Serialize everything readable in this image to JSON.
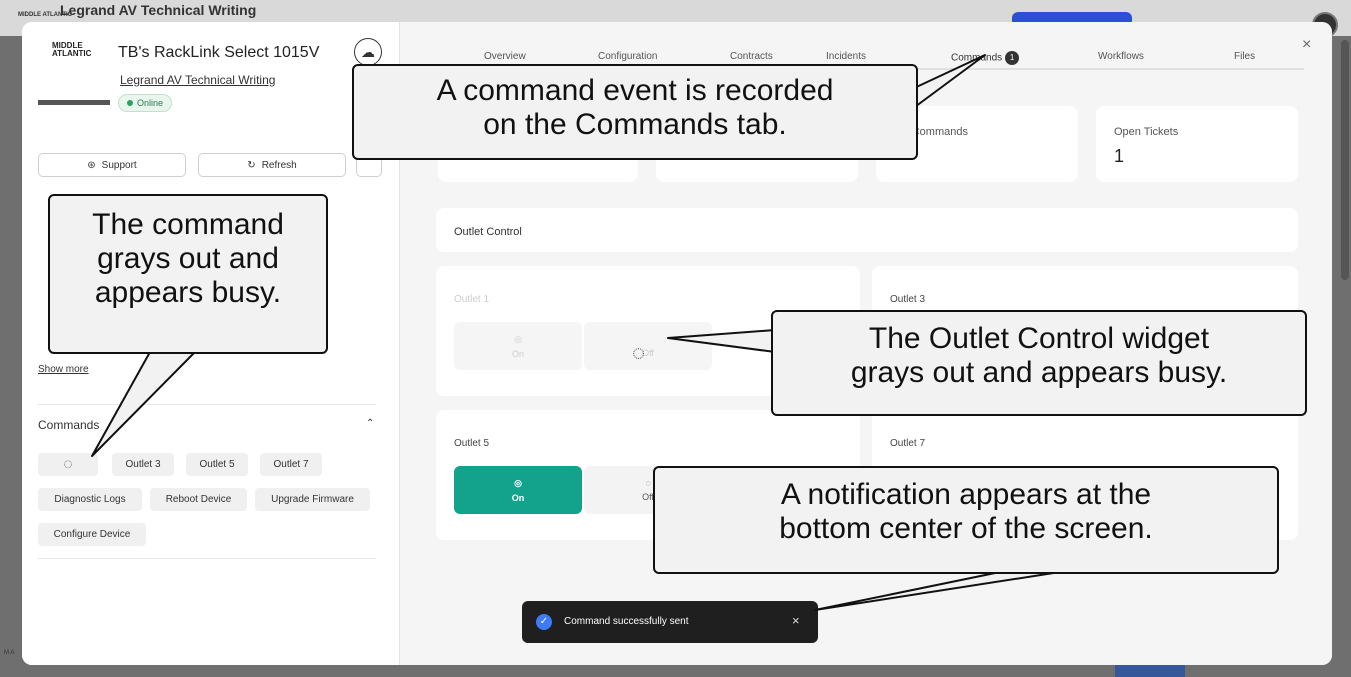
{
  "background": {
    "app_title": "Legrand AV Technical Writing",
    "logo_mini": "MIDDLE ATLANTIC"
  },
  "device": {
    "brand_top": "MIDDLE",
    "brand_bottom": "ATLANTIC",
    "title": "TB's RackLink Select 1015V",
    "owner": "Legrand AV Technical Writing",
    "status": "Online",
    "support_label": "Support",
    "refresh_label": "Refresh",
    "show_more": "Show more"
  },
  "commands": {
    "heading": "Commands",
    "buttons": [
      "Outlet 3",
      "Outlet 5",
      "Outlet 7",
      "Diagnostic Logs",
      "Reboot Device",
      "Upgrade Firmware",
      "Configure Device"
    ]
  },
  "tabs": [
    "Overview",
    "Configuration",
    "Contracts",
    "Incidents",
    "Commands",
    "Workflows",
    "Files"
  ],
  "commands_badge": "1",
  "stats": [
    {
      "label": "ing Commands",
      "value": ""
    },
    {
      "label": "Open Tickets",
      "value": "1"
    }
  ],
  "outlet_control": {
    "title": "Outlet Control",
    "outlets": [
      {
        "name": "Outlet 1",
        "on": "On",
        "off": "Off",
        "state": "busy"
      },
      {
        "name": "Outlet 3",
        "state": "busy"
      },
      {
        "name": "Outlet 5",
        "on": "On",
        "off": "Off",
        "state": "on"
      },
      {
        "name": "Outlet 7",
        "state": "busy"
      }
    ]
  },
  "toast": {
    "message": "Command successfully sent"
  },
  "callouts": {
    "commands_tab": [
      "A command event is recorded",
      "on the Commands tab."
    ],
    "command_busy": [
      "The command",
      "grays out and",
      "appears busy."
    ],
    "widget_busy": [
      "The Outlet Control widget",
      "grays out and appears busy."
    ],
    "notification": [
      "A notification appears at the",
      "bottom center of the screen."
    ]
  },
  "colors": {
    "accent_on": "#13a38d",
    "toast_bg": "#1f1f1f",
    "online": "#28a35d",
    "primary_blue": "#2d4fd8"
  }
}
